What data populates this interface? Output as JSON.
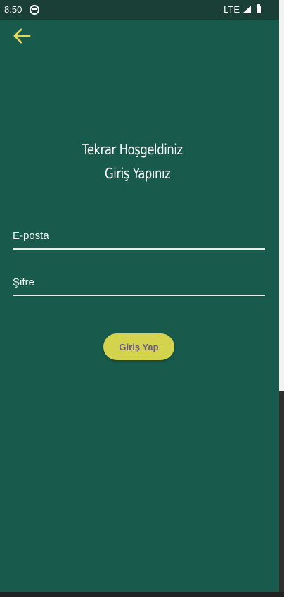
{
  "status_bar": {
    "time": "8:50",
    "network": "LTE"
  },
  "header": {
    "back_icon": "arrow-left-icon"
  },
  "main": {
    "title_line1": "Tekrar Hoşgeldiniz",
    "title_line2": "Giriş Yapınız",
    "email_placeholder": "E-posta",
    "password_placeholder": "Şifre",
    "login_button_label": "Giriş Yap"
  },
  "colors": {
    "background": "#185a4b",
    "status_bar": "#1a3f37",
    "accent": "#d4d34d",
    "button_text": "#6b5a88",
    "back_arrow": "#e2d75a"
  }
}
